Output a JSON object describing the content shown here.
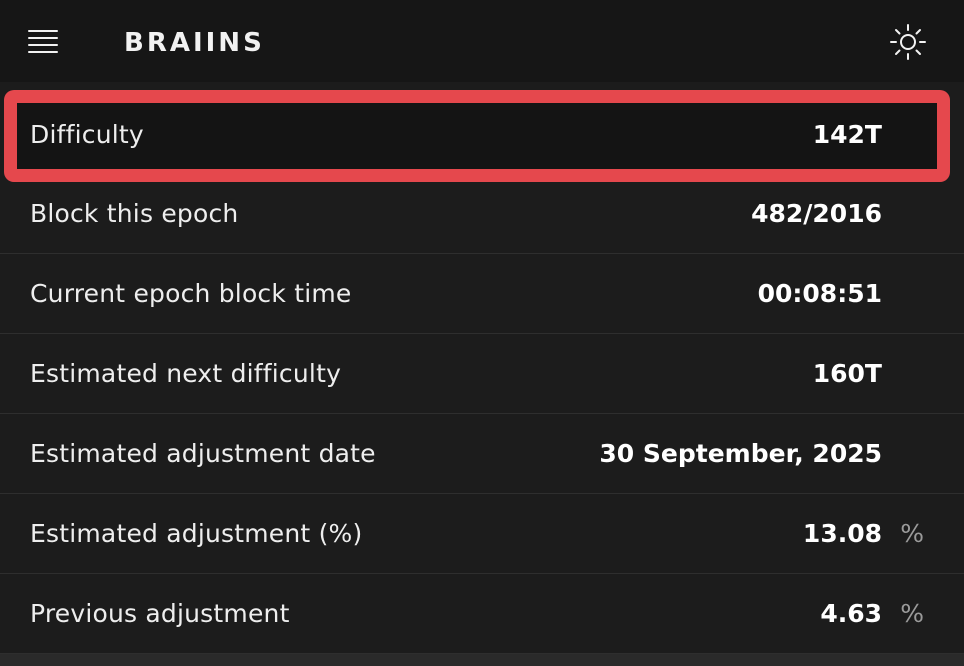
{
  "header": {
    "brand": "BRAIINS",
    "menu_icon": "hamburger-menu-icon",
    "theme_icon": "sun-icon"
  },
  "stats": {
    "rows": [
      {
        "label": "Difficulty",
        "value": "142T",
        "unit": ""
      },
      {
        "label": "Block this epoch",
        "value": "482/2016",
        "unit": ""
      },
      {
        "label": "Current epoch block time",
        "value": "00:08:51",
        "unit": ""
      },
      {
        "label": "Estimated next difficulty",
        "value": "160T",
        "unit": ""
      },
      {
        "label": "Estimated adjustment date",
        "value": "30 September, 2025",
        "unit": ""
      },
      {
        "label": "Estimated adjustment (%)",
        "value": "13.08",
        "unit": "%"
      },
      {
        "label": "Previous adjustment",
        "value": "4.63",
        "unit": "%"
      }
    ]
  },
  "colors": {
    "background": "#1c1c1c",
    "header_background": "#161616",
    "highlight": "#e5484d",
    "text": "#f2f2f2",
    "muted": "#9a9a9a"
  }
}
